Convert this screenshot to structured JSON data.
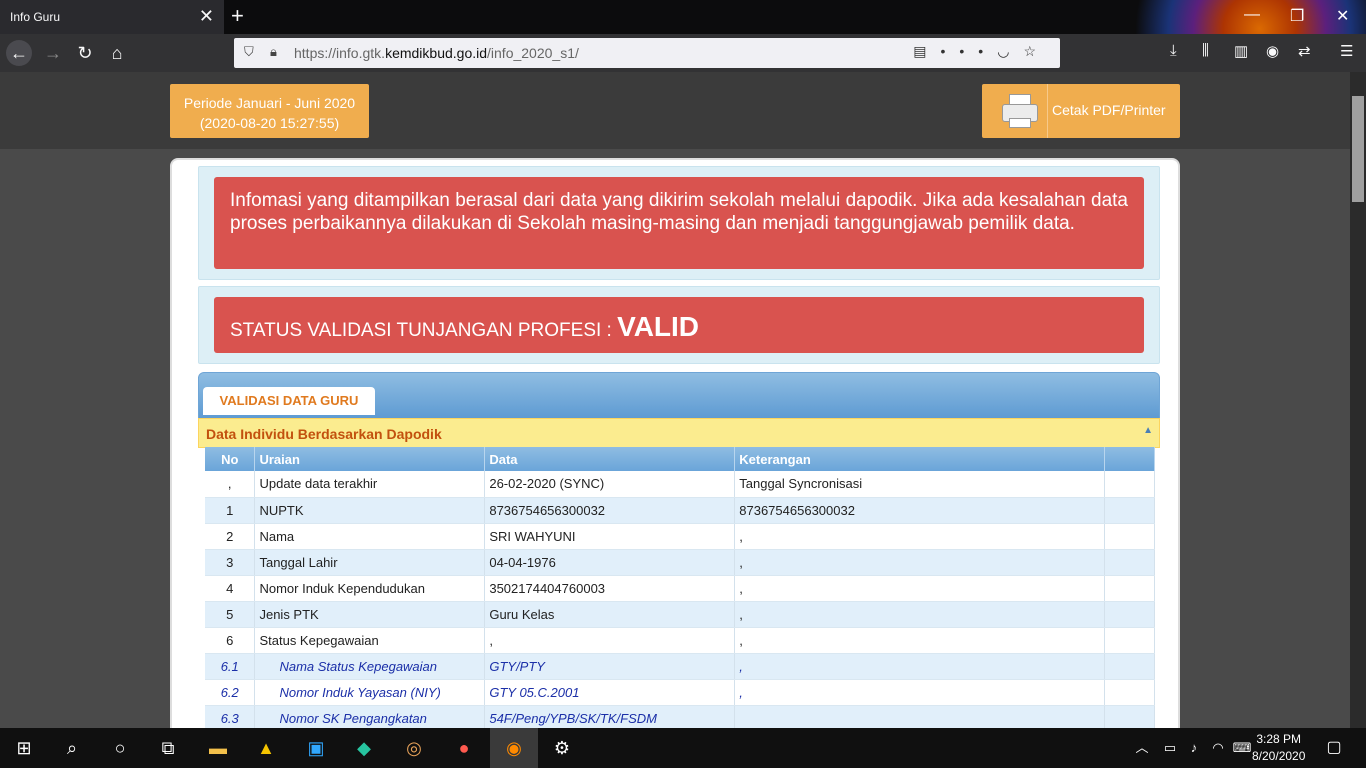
{
  "browser": {
    "tab_title": "Info Guru",
    "url_prefix": "https://info.gtk.",
    "url_domain": "kemdikbud.go.id",
    "url_path": "/info_2020_s1/"
  },
  "header": {
    "periode_line1": "Periode Januari - Juni 2020",
    "periode_line2": "(2020-08-20 15:27:55)",
    "print_label": "Cetak PDF/Printer"
  },
  "notice": {
    "text": "Infomasi yang ditampilkan berasal dari data yang dikirim sekolah melalui dapodik. Jika ada kesalahan data proses perbaikannya dilakukan di Sekolah masing-masing dan menjadi tanggungjawab pemilik data."
  },
  "status": {
    "label": "STATUS VALIDASI TUNJANGAN PROFESI : ",
    "value": "VALID"
  },
  "tabs": {
    "active": "VALIDASI DATA GURU"
  },
  "section": {
    "title": "Data Individu Berdasarkan Dapodik"
  },
  "table": {
    "headers": [
      "No",
      "Uraian",
      "Data",
      "Keterangan"
    ],
    "rows": [
      {
        "no": ",",
        "uraian": "Update data terakhir",
        "data": "26-02-2020 (SYNC)",
        "keterangan": "Tanggal Syncronisasi"
      },
      {
        "no": "1",
        "uraian": "NUPTK",
        "data": "8736754656300032",
        "keterangan": "8736754656300032"
      },
      {
        "no": "2",
        "uraian": "Nama",
        "data": "SRI WAHYUNI",
        "keterangan": ","
      },
      {
        "no": "3",
        "uraian": "Tanggal Lahir",
        "data": "04-04-1976",
        "keterangan": ","
      },
      {
        "no": "4",
        "uraian": "Nomor Induk Kependudukan",
        "data": "3502174404760003",
        "keterangan": ","
      },
      {
        "no": "5",
        "uraian": "Jenis PTK",
        "data": "Guru Kelas",
        "keterangan": ","
      },
      {
        "no": "6",
        "uraian": "Status Kepegawaian",
        "data": ",",
        "keterangan": ","
      },
      {
        "no": "6.1",
        "uraian": "Nama Status Kepegawaian",
        "data": "GTY/PTY",
        "keterangan": ","
      },
      {
        "no": "6.2",
        "uraian": "Nomor Induk Yayasan (NIY)",
        "data": "GTY 05.C.2001",
        "keterangan": ","
      },
      {
        "no": "6.3",
        "uraian": "Nomor SK Pengangkatan",
        "data": "54F/Peng/YPB/SK/TK/FSDM",
        "keterangan": ""
      }
    ]
  },
  "taskbar": {
    "time": "3:28 PM",
    "date": "8/20/2020"
  }
}
